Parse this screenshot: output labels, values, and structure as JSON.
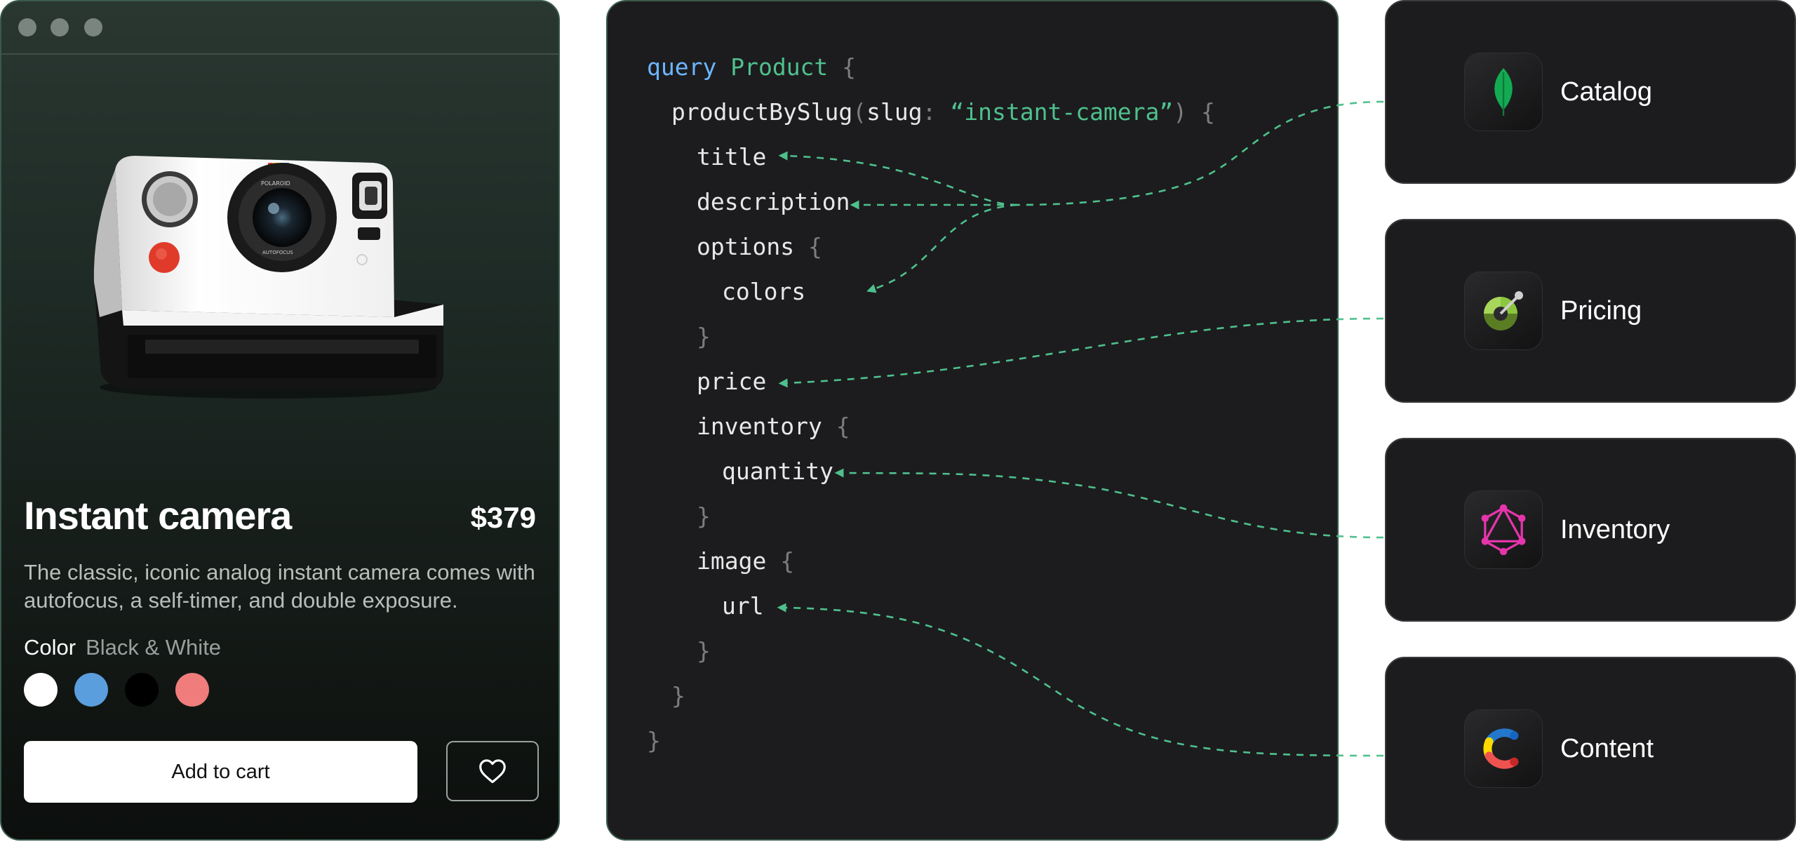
{
  "product": {
    "window_dots": [
      "dot",
      "dot",
      "dot"
    ],
    "title": "Instant camera",
    "price": "$379",
    "description": "The classic, iconic analog instant camera comes with autofocus, a self-timer, and double exposure.",
    "color_label": "Color",
    "color_value": "Black & White",
    "swatches": [
      "#ffffff",
      "#5a9ede",
      "#000000",
      "#f07c7c"
    ],
    "add_to_cart_label": "Add to cart",
    "wishlist_icon": "heart-icon",
    "camera_branding": [
      "POLAROID",
      "AUTOFOCUS"
    ]
  },
  "query": {
    "keyword": "query",
    "name": "Product",
    "open_brace": "{",
    "field_call": "productBySlug",
    "arg_name": "slug",
    "arg_value": "“instant-camera”",
    "fields": {
      "title": "title",
      "description": "description",
      "options": "options",
      "colors": "colors",
      "price": "price",
      "inventory": "inventory",
      "quantity": "quantity",
      "image": "image",
      "url": "url"
    },
    "close_brace": "}"
  },
  "services": [
    {
      "name": "Catalog",
      "icon": "leaf-icon",
      "color": "#13aa52"
    },
    {
      "name": "Pricing",
      "icon": "gauge-icon",
      "color": "#8cc63f"
    },
    {
      "name": "Inventory",
      "icon": "graphql-icon",
      "color": "#e535ab"
    },
    {
      "name": "Content",
      "icon": "contentful-icon",
      "color": "#ffda00"
    }
  ],
  "connector_color": "#4fc08d"
}
